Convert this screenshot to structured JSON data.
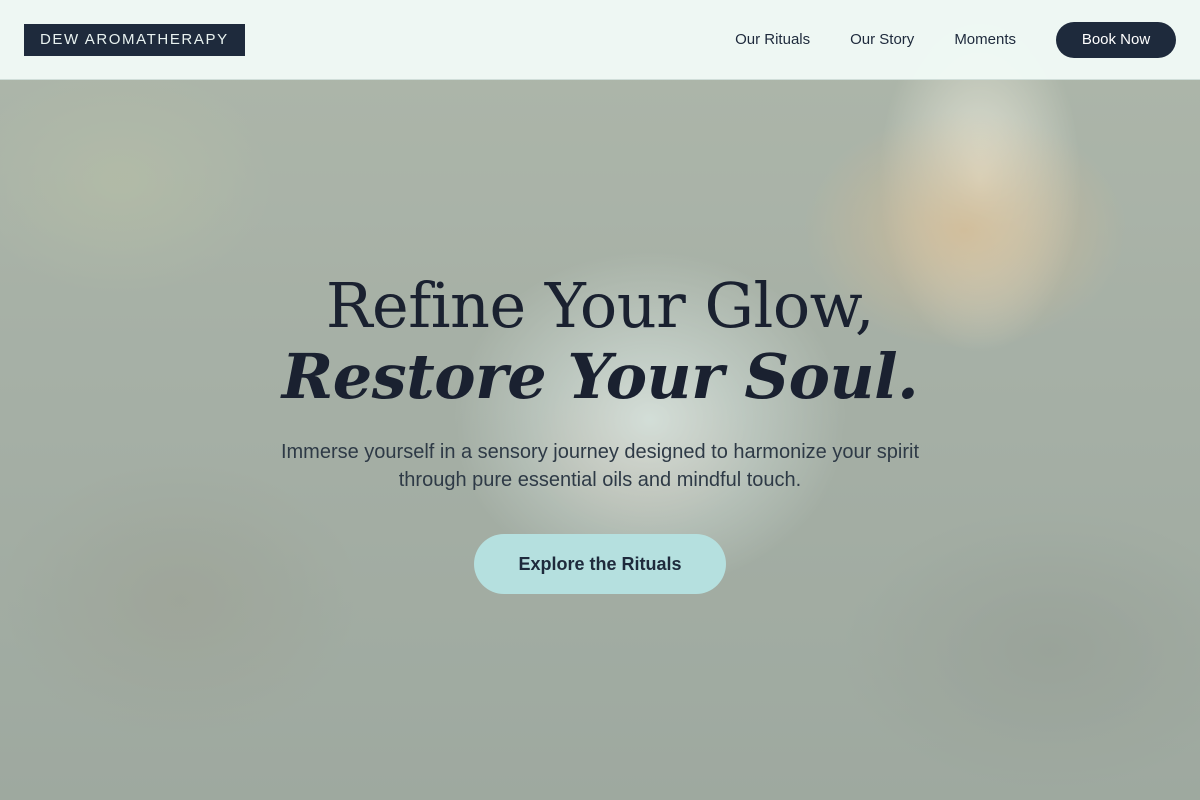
{
  "header": {
    "logo": "DEW AROMATHERAPY",
    "nav": [
      {
        "label": "Our Rituals"
      },
      {
        "label": "Our Story"
      },
      {
        "label": "Moments"
      }
    ],
    "cta_label": "Book Now"
  },
  "hero": {
    "headline_line1": "Refine Your Glow,",
    "headline_line2": "Restore Your Soul.",
    "subtext": "Immerse yourself in a sensory journey designed to harmonize your spirit through pure essential oils and mindful touch.",
    "cta_label": "Explore the Rituals"
  },
  "colors": {
    "navy": "#1e2a3c",
    "mint": "#b5e0df",
    "header_bg": "#f0faf6"
  }
}
